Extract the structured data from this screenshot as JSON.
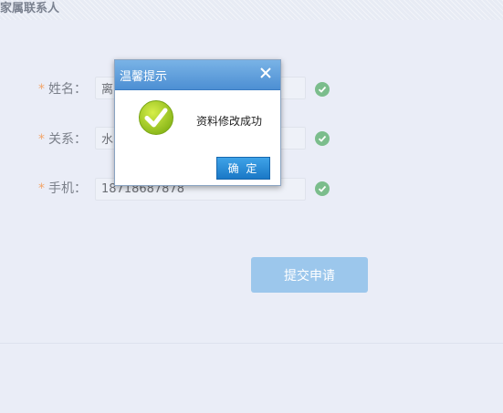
{
  "section": {
    "title": "家属联系人"
  },
  "form": {
    "rows": [
      {
        "label": "姓名：",
        "value": "离"
      },
      {
        "label": "关系：",
        "value": "水"
      },
      {
        "label": "手机：",
        "value": "18718687878"
      }
    ],
    "required_mark": "*",
    "submit_label": "提交申请"
  },
  "dialog": {
    "title": "温馨提示",
    "message": "资料修改成功",
    "ok_label": "确 定"
  },
  "colors": {
    "page_bg": "#eaedf7",
    "dialog_header": "#4d8fd3",
    "ok_button": "#1a78c6",
    "submit_button": "#9cc7ec",
    "check_badge": "#7bbd8c",
    "required_star": "#f2a56a"
  },
  "icons": {
    "dialog_close": "close-icon",
    "dialog_status": "success-check-icon",
    "field_valid": "check-icon"
  }
}
